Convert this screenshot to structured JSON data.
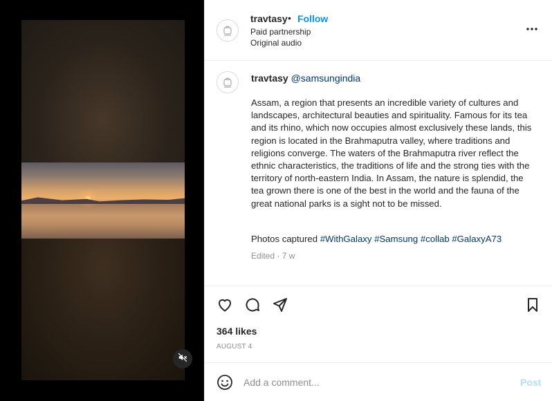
{
  "post": {
    "username": "travtasy",
    "separator": "•",
    "follow_label": "Follow",
    "paid_partnership": "Paid partnership",
    "audio": "Original audio",
    "more_icon": "more-horizontal-icon"
  },
  "caption": {
    "username": "travtasy",
    "mention": "@samsungindia",
    "text": "Assam, a region that presents an incredible variety of cultures and landscapes, architectural beauties and spirituality. Famous for its tea and its rhino, which now occupies almost exclusively these lands, this region is located in the Brahmaputra valley, where traditions and religions converge. The waters of the Brahmaputra river reflect the ethnic characteristics, the traditions of life and the strong ties with the territory of north-eastern India. In Assam, the nature is splendid, the tea grown there is one of the best in the world and the fauna of the great national parks is a sight not to be missed.",
    "tags_prefix": "Photos captured",
    "tags": [
      "#WithGalaxy",
      "#Samsung",
      "#collab",
      "#GalaxyA73"
    ],
    "edited": "Edited · 7 w"
  },
  "engagement": {
    "likes": "364 likes",
    "date": "AUGUST 4"
  },
  "comment": {
    "placeholder": "Add a comment...",
    "post_label": "Post"
  },
  "colors": {
    "link": "#0095f6",
    "tag": "#00376b",
    "muted": "#8e8e8e",
    "post_disabled": "#b2dffc"
  }
}
